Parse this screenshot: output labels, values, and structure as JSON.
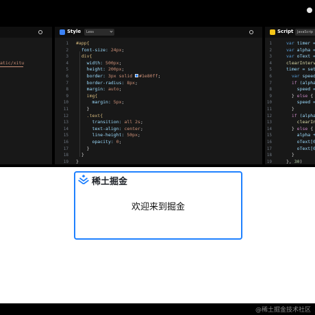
{
  "style_panel": {
    "title": "Style",
    "lang": "Less",
    "line_numbers": [
      "1",
      "2",
      "3",
      "4",
      "5",
      "6",
      "7",
      "8",
      "9",
      "10",
      "11",
      "12",
      "13",
      "14",
      "15",
      "16",
      "17",
      "18",
      "19"
    ],
    "lines": [
      [
        {
          "t": "#app{",
          "c": "#d7ba7d"
        }
      ],
      [
        {
          "t": "  font-size: ",
          "c": "#9cdcfe"
        },
        {
          "t": "24px",
          "c": "#ce9178"
        },
        {
          "t": ";",
          "c": "#d4d4d4"
        }
      ],
      [
        {
          "t": "  div{",
          "c": "#d7ba7d"
        }
      ],
      [
        {
          "t": "    width: ",
          "c": "#9cdcfe"
        },
        {
          "t": "500px",
          "c": "#ce9178"
        },
        {
          "t": ";",
          "c": "#d4d4d4"
        }
      ],
      [
        {
          "t": "    height: ",
          "c": "#9cdcfe"
        },
        {
          "t": "200px",
          "c": "#ce9178"
        },
        {
          "t": ";",
          "c": "#d4d4d4"
        }
      ],
      [
        {
          "t": "    border: ",
          "c": "#9cdcfe"
        },
        {
          "t": "3px solid ",
          "c": "#ce9178"
        },
        {
          "sw": true
        },
        {
          "t": "#1e80ff",
          "c": "#ce9178"
        },
        {
          "t": ";",
          "c": "#d4d4d4"
        }
      ],
      [
        {
          "t": "    border-radius: ",
          "c": "#9cdcfe"
        },
        {
          "t": "8px",
          "c": "#ce9178"
        },
        {
          "t": ";",
          "c": "#d4d4d4"
        }
      ],
      [
        {
          "t": "    margin: ",
          "c": "#9cdcfe"
        },
        {
          "t": "auto",
          "c": "#ce9178"
        },
        {
          "t": ";",
          "c": "#d4d4d4"
        }
      ],
      [
        {
          "t": "    img{",
          "c": "#d7ba7d"
        }
      ],
      [
        {
          "t": "      margin: ",
          "c": "#9cdcfe"
        },
        {
          "t": "5px",
          "c": "#ce9178"
        },
        {
          "t": ";",
          "c": "#d4d4d4"
        }
      ],
      [
        {
          "t": "    }",
          "c": "#d4d4d4"
        }
      ],
      [
        {
          "t": "    .text{",
          "c": "#d7ba7d"
        }
      ],
      [
        {
          "t": "      transition: ",
          "c": "#9cdcfe"
        },
        {
          "t": "all 2s",
          "c": "#ce9178"
        },
        {
          "t": ";",
          "c": "#d4d4d4"
        }
      ],
      [
        {
          "t": "      text-align: ",
          "c": "#9cdcfe"
        },
        {
          "t": "center",
          "c": "#ce9178"
        },
        {
          "t": ";",
          "c": "#d4d4d4"
        }
      ],
      [
        {
          "t": "      line-height: ",
          "c": "#9cdcfe"
        },
        {
          "t": "50px",
          "c": "#ce9178"
        },
        {
          "t": ";",
          "c": "#d4d4d4"
        }
      ],
      [
        {
          "t": "      opacity: ",
          "c": "#9cdcfe"
        },
        {
          "t": "0",
          "c": "#ce9178"
        },
        {
          "t": ";",
          "c": "#d4d4d4"
        }
      ],
      [
        {
          "t": "    }",
          "c": "#d4d4d4"
        }
      ],
      [
        {
          "t": "  }",
          "c": "#d4d4d4"
        }
      ],
      [
        {
          "t": "}",
          "c": "#d4d4d4"
        }
      ]
    ]
  },
  "script_panel": {
    "title": "Script",
    "lang": "JavaScrip",
    "line_numbers": [
      "1",
      "2",
      "3",
      "4",
      "5",
      "6",
      "7",
      "8",
      "9",
      "10",
      "11",
      "12",
      "13",
      "14",
      "15",
      "16",
      "17",
      "18",
      "19"
    ],
    "lines": [
      [
        {
          "t": "var ",
          "c": "#569cd6"
        },
        {
          "t": "timer =",
          "c": "#9cdcfe"
        }
      ],
      [
        {
          "t": "var ",
          "c": "#569cd6"
        },
        {
          "t": "alpha =",
          "c": "#9cdcfe"
        }
      ],
      [
        {
          "t": "var ",
          "c": "#569cd6"
        },
        {
          "t": "oText =",
          "c": "#9cdcfe"
        }
      ],
      [
        {
          "t": "clearInterva",
          "c": "#dcdcaa"
        }
      ],
      [
        {
          "t": "timer = set",
          "c": "#9cdcfe"
        }
      ],
      [
        {
          "t": "  var ",
          "c": "#569cd6"
        },
        {
          "t": "speed",
          "c": "#9cdcfe"
        }
      ],
      [
        {
          "t": "  if ",
          "c": "#c586c0"
        },
        {
          "t": "(alpha",
          "c": "#9cdcfe"
        }
      ],
      [
        {
          "t": "    speed =",
          "c": "#9cdcfe"
        }
      ],
      [
        {
          "t": "  } ",
          "c": "#d4d4d4"
        },
        {
          "t": "else ",
          "c": "#c586c0"
        },
        {
          "t": "{",
          "c": "#d4d4d4"
        }
      ],
      [
        {
          "t": "    speed =",
          "c": "#9cdcfe"
        }
      ],
      [
        {
          "t": "  }",
          "c": "#d4d4d4"
        }
      ],
      [
        {
          "t": "  if ",
          "c": "#c586c0"
        },
        {
          "t": "(alpha",
          "c": "#9cdcfe"
        }
      ],
      [
        {
          "t": "    clearIn",
          "c": "#dcdcaa"
        }
      ],
      [
        {
          "t": "  } ",
          "c": "#d4d4d4"
        },
        {
          "t": "else ",
          "c": "#c586c0"
        },
        {
          "t": "{",
          "c": "#d4d4d4"
        }
      ],
      [
        {
          "t": "    alpha +",
          "c": "#9cdcfe"
        }
      ],
      [
        {
          "t": "    oText[0",
          "c": "#9cdcfe"
        }
      ],
      [
        {
          "t": "    oText[0",
          "c": "#9cdcfe"
        }
      ],
      [
        {
          "t": "  }",
          "c": "#d4d4d4"
        }
      ],
      [
        {
          "t": "}, ",
          "c": "#d4d4d4"
        },
        {
          "t": "30",
          "c": "#b5cea8"
        },
        {
          "t": ")",
          "c": "#d4d4d4"
        }
      ]
    ]
  },
  "left_panel": {
    "partial_code": "atic/xitu"
  },
  "preview": {
    "brand": "稀土掘金",
    "welcome": "欢迎来到掘金"
  },
  "watermark": "@稀土掘金技术社区",
  "colors": {
    "accent": "#1e80ff",
    "style_icon": "#3b82f6",
    "script_icon": "#f5c518",
    "editor_bg": "#181818"
  }
}
